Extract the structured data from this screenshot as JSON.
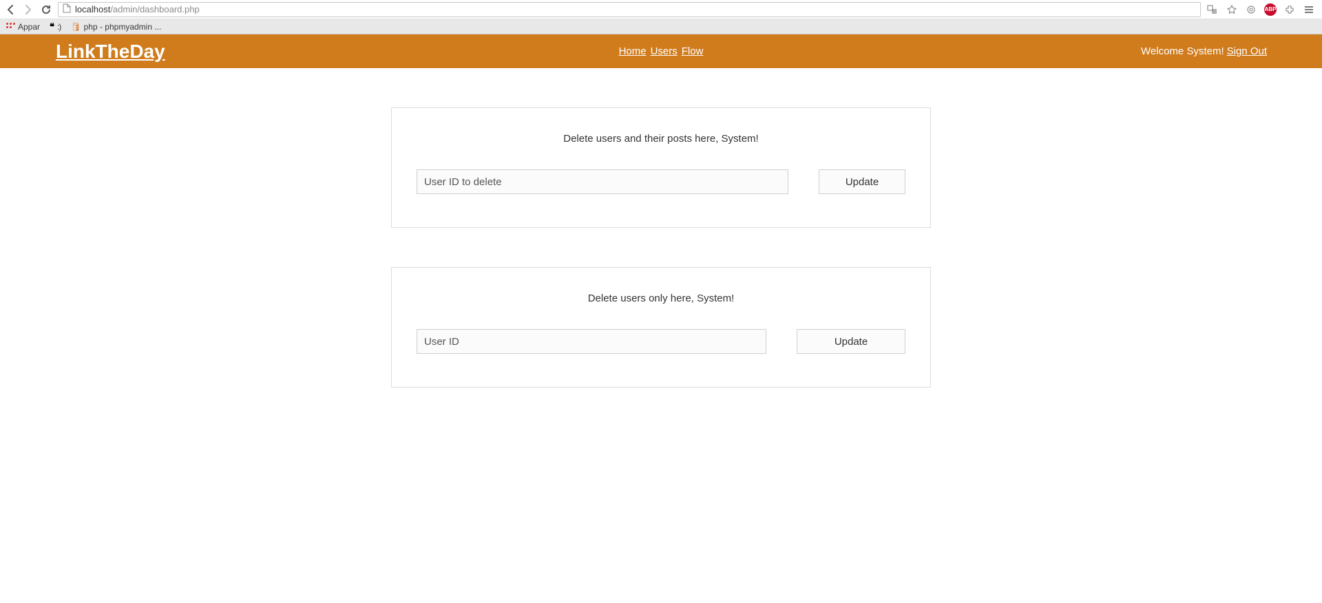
{
  "browser": {
    "url_host": "localhost",
    "url_path": "/admin/dashboard.php",
    "bookmarks": {
      "appar": "Appar",
      "quotes": ":)",
      "php": "php - phpmyadmin ..."
    },
    "abp": "ABP"
  },
  "header": {
    "brand": "LinkTheDay",
    "nav": {
      "home": "Home",
      "users": "Users",
      "flow": "Flow"
    },
    "welcome": "Welcome System!",
    "signout": "Sign Out"
  },
  "panel1": {
    "title": "Delete users and their posts here, System!",
    "placeholder": "User ID to delete",
    "button": "Update"
  },
  "panel2": {
    "title": "Delete users only here, System!",
    "placeholder": "User ID",
    "button": "Update"
  }
}
